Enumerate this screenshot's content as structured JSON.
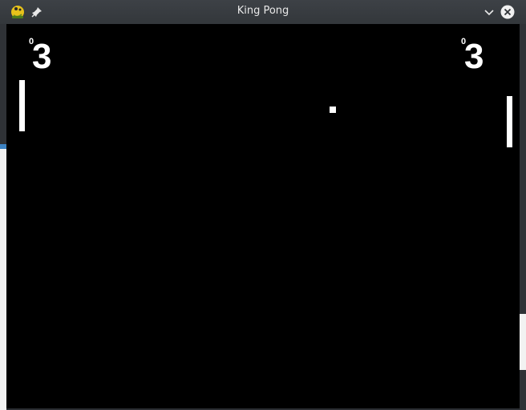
{
  "window": {
    "title": "King Pong",
    "app_icon": "pygame-snake-icon",
    "pin_icon": "pin-icon",
    "minimize_icon": "chevron-down-icon",
    "close_icon": "close-icon"
  },
  "game": {
    "left_score": {
      "small": "0",
      "big": "3"
    },
    "right_score": {
      "small": "0",
      "big": "3"
    },
    "background_color": "#000000",
    "foreground_color": "#ffffff"
  }
}
